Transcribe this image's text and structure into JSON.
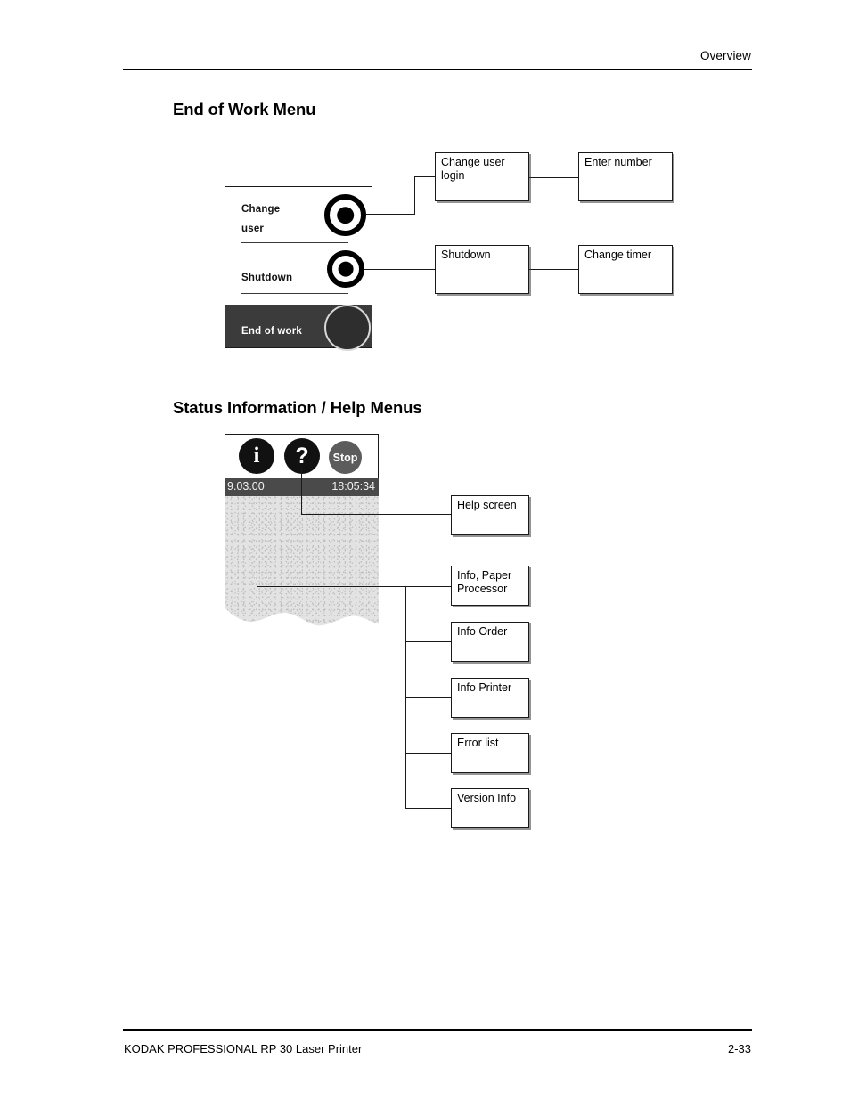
{
  "header": {
    "running_head": "Overview"
  },
  "footer": {
    "document_title": "KODAK PROFESSIONAL RP 30 Laser Printer",
    "page_number": "2-33"
  },
  "sections": [
    {
      "id": "end-of-work",
      "heading": "End of Work Menu",
      "panel": {
        "rows": [
          {
            "label_line1": "Change",
            "label_line2": "user"
          },
          {
            "label_line1": "Shutdown",
            "label_line2": ""
          }
        ],
        "footer_button_label": "End of work"
      },
      "flow": {
        "level1": [
          {
            "label": "Change user\nlogin"
          },
          {
            "label": "Shutdown"
          }
        ],
        "level2": [
          {
            "label": "Enter number"
          },
          {
            "label": "Change timer"
          }
        ]
      }
    },
    {
      "id": "status-help",
      "heading": "Status Information / Help Menus",
      "panel": {
        "icons": [
          {
            "name": "info-icon",
            "glyph": "i"
          },
          {
            "name": "help-icon",
            "glyph": "?"
          },
          {
            "name": "stop-icon",
            "glyph": "Stop"
          }
        ],
        "statusbar": {
          "left": "9.03.00",
          "right": "18:05:34"
        }
      },
      "flow": {
        "help_branch": [
          {
            "label": "Help screen"
          }
        ],
        "info_branch": [
          {
            "label": "Info, Paper\nProcessor"
          },
          {
            "label": "Info Order"
          },
          {
            "label": "Info Printer"
          },
          {
            "label": "Error list"
          },
          {
            "label": "Version Info"
          }
        ]
      }
    }
  ],
  "colors": {
    "ink": "#000000",
    "panel_dark_bar": "#3b3b3b",
    "status_bar": "#4a4a4a",
    "stop_button": "#5c5c5c",
    "screen_fill": "#e3e3e3"
  }
}
